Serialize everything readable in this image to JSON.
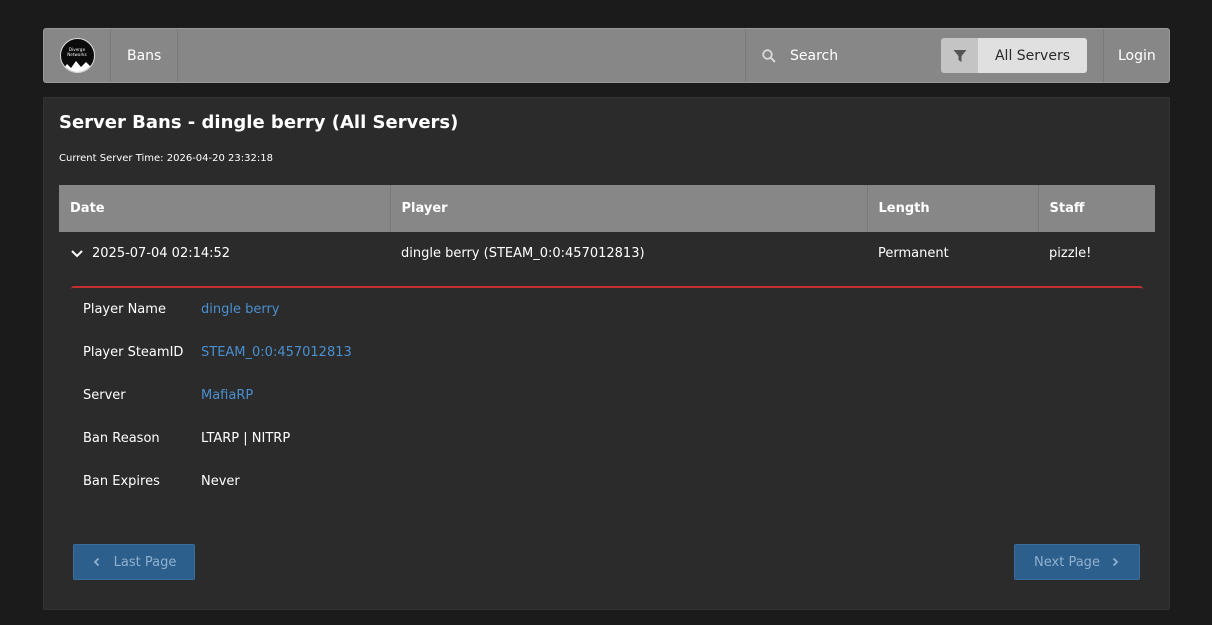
{
  "navbar": {
    "logo_text_line1": "Diverge",
    "logo_text_line2": "Networks",
    "bans_label": "Bans",
    "search_placeholder": "Search",
    "server_filter_label": "All Servers",
    "login_label": "Login"
  },
  "page": {
    "title": "Server Bans - dingle berry (All Servers)",
    "server_time_label": "Current Server Time:",
    "server_time_value": "2026-04-20 23:32:18"
  },
  "table": {
    "headers": [
      "Date",
      "Player",
      "Length",
      "Staff"
    ],
    "rows": [
      {
        "date": "2025-07-04 02:14:52",
        "player": "dingle berry (STEAM_0:0:457012813)",
        "length": "Permanent",
        "staff": "pizzle!"
      }
    ]
  },
  "details": {
    "player_name_label": "Player Name",
    "player_name_value": "dingle berry",
    "steamid_label": "Player SteamID",
    "steamid_value": "STEAM_0:0:457012813",
    "server_label": "Server",
    "server_value": "MafiaRP",
    "reason_label": "Ban Reason",
    "reason_value": "LTARP | NITRP",
    "expires_label": "Ban Expires",
    "expires_value": "Never"
  },
  "pagination": {
    "prev_label": "Last Page",
    "next_label": "Next Page"
  },
  "colors": {
    "navbar_bg": "#878787",
    "panel_bg": "#2b2b2b",
    "page_bg": "#1b1b1b",
    "link": "#4a8fd0",
    "detail_border": "#c42f2f",
    "button_bg": "#2d5f8c"
  },
  "icons": {
    "search": "search-icon",
    "filter": "filter-icon",
    "expand": "chevron-down-icon",
    "prev": "chevron-left-icon",
    "next": "chevron-right-icon"
  }
}
